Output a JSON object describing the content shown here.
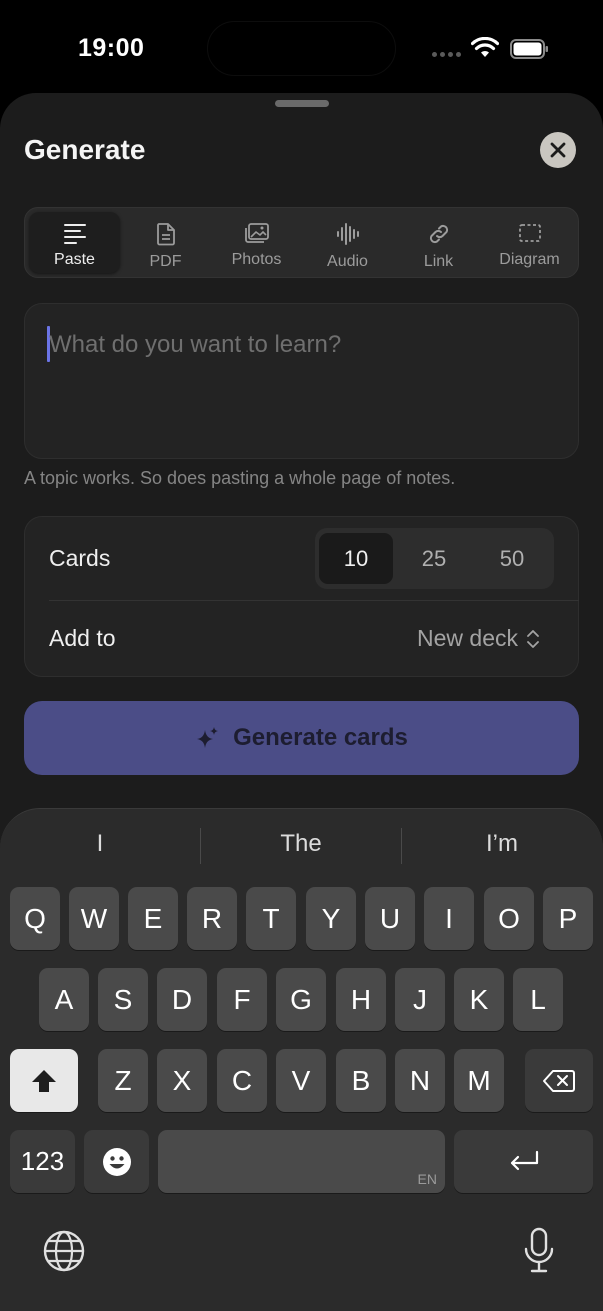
{
  "status": {
    "time": "19:00"
  },
  "header": {
    "title": "Generate"
  },
  "tabs": [
    {
      "label": "Paste",
      "icon": "paste-icon",
      "active": true
    },
    {
      "label": "PDF",
      "icon": "document-icon",
      "active": false
    },
    {
      "label": "Photos",
      "icon": "photos-icon",
      "active": false
    },
    {
      "label": "Audio",
      "icon": "waveform-icon",
      "active": false
    },
    {
      "label": "Link",
      "icon": "link-icon",
      "active": false
    },
    {
      "label": "Diagram",
      "icon": "dashed-frame-icon",
      "active": false
    }
  ],
  "input": {
    "placeholder": "What do you want to learn?",
    "value": ""
  },
  "hint": "A topic works. So does pasting a whole page of notes.",
  "settings": {
    "cards_label": "Cards",
    "card_options": [
      "10",
      "25",
      "50"
    ],
    "selected_cards": "10",
    "add_to_label": "Add to",
    "deck_value": "New deck"
  },
  "generate_button": {
    "label": "Generate cards"
  },
  "keyboard": {
    "suggestions": [
      "I",
      "The",
      "I’m"
    ],
    "row1": [
      "Q",
      "W",
      "E",
      "R",
      "T",
      "Y",
      "U",
      "I",
      "O",
      "P"
    ],
    "row2": [
      "A",
      "S",
      "D",
      "F",
      "G",
      "H",
      "J",
      "K",
      "L"
    ],
    "row3": [
      "Z",
      "X",
      "C",
      "V",
      "B",
      "N",
      "M"
    ],
    "numbers_label": "123",
    "space_lang": "EN"
  },
  "colors": {
    "accent": "#4b4d87",
    "sheet": "#1c1c1c",
    "caret": "#6b74e6"
  }
}
